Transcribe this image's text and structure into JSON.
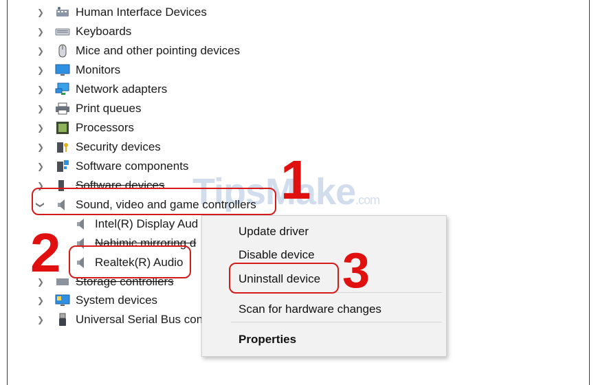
{
  "tree": {
    "categories": [
      {
        "label": "Human Interface Devices",
        "icon": "hid-icon"
      },
      {
        "label": "Keyboards",
        "icon": "keyboard-icon"
      },
      {
        "label": "Mice and other pointing devices",
        "icon": "mouse-icon"
      },
      {
        "label": "Monitors",
        "icon": "monitor-icon"
      },
      {
        "label": "Network adapters",
        "icon": "network-adapter-icon"
      },
      {
        "label": "Print queues",
        "icon": "printer-icon"
      },
      {
        "label": "Processors",
        "icon": "processor-icon"
      },
      {
        "label": "Security devices",
        "icon": "security-device-icon"
      },
      {
        "label": "Software components",
        "icon": "software-component-icon"
      },
      {
        "label": "Software devices",
        "icon": "software-device-icon"
      },
      {
        "label": "Sound, video and game controllers",
        "icon": "speaker-icon",
        "expanded": true
      },
      {
        "label": "Storage controllers",
        "icon": "storage-icon"
      },
      {
        "label": "System devices",
        "icon": "system-devices-icon"
      },
      {
        "label": "Universal Serial Bus con",
        "icon": "usb-icon"
      }
    ],
    "children": [
      {
        "label": "Intel(R) Display Aud",
        "icon": "speaker-icon"
      },
      {
        "label": "Nahimic mirroring d",
        "icon": "speaker-icon"
      },
      {
        "label": "Realtek(R) Audio",
        "icon": "speaker-icon"
      }
    ]
  },
  "context_menu": {
    "update": "Update driver",
    "disable": "Disable device",
    "uninstall": "Uninstall device",
    "scan": "Scan for hardware changes",
    "properties": "Properties"
  },
  "annotations": {
    "step1": "1",
    "step2": "2",
    "step3": "3",
    "color": "#e01010"
  },
  "watermark": {
    "text": "TipsMake",
    "suffix": ".com"
  }
}
